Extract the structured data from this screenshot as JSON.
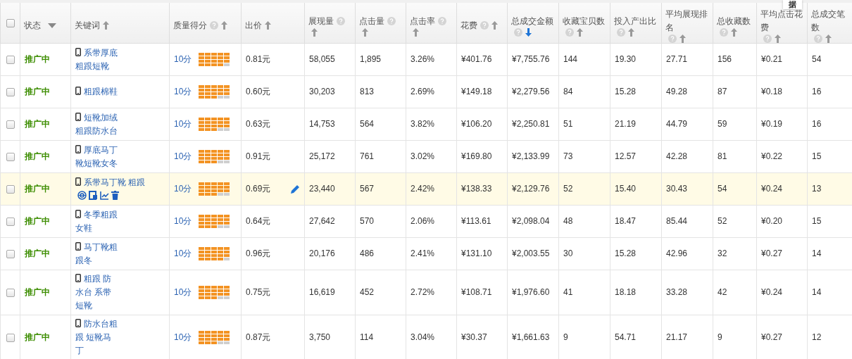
{
  "select_all": {
    "checked": false
  },
  "columns": [
    {
      "label": "状态",
      "help": false,
      "kind": "filter",
      "sorted": false
    },
    {
      "label": "关键词",
      "help": false,
      "kind": "sortable",
      "sorted": false
    },
    {
      "label": "质量得分",
      "help": true,
      "kind": "sortable",
      "sorted": false
    },
    {
      "label": "出价",
      "help": false,
      "kind": "sortable",
      "sorted": false
    },
    {
      "label": "展现量",
      "help": true,
      "kind": "sortable",
      "sorted": false
    },
    {
      "label": "点击量",
      "help": true,
      "kind": "sortable",
      "sorted": false
    },
    {
      "label": "点击率",
      "help": true,
      "kind": "sortable",
      "sorted": false
    },
    {
      "label": "花费",
      "help": true,
      "kind": "sortable",
      "sorted": false
    },
    {
      "label": "总成交金额",
      "help": true,
      "kind": "sortable",
      "sorted": true
    },
    {
      "label": "收藏宝贝数",
      "help": true,
      "kind": "sortable",
      "sorted": false
    },
    {
      "label": "投入产出比",
      "help": true,
      "kind": "sortable",
      "sorted": false
    },
    {
      "label": "平均展现排名",
      "help": true,
      "kind": "sortable",
      "sorted": false
    },
    {
      "label": "总收藏数",
      "help": true,
      "kind": "sortable",
      "sorted": false
    },
    {
      "label": "平均点击花费",
      "help": true,
      "kind": "sortable",
      "sorted": false
    },
    {
      "label": "总成交笔数",
      "help": true,
      "kind": "sortable",
      "sorted": false
    }
  ],
  "tooltip": "据",
  "rows": [
    {
      "checked": false,
      "highlighted": false,
      "status": "推广中",
      "keyword": "系带厚底粗跟短靴",
      "quality": {
        "score": "10分",
        "level": 0.95
      },
      "bid": "0.81元",
      "metrics": [
        "58,055",
        "1,895",
        "3.26%",
        "¥401.76",
        "¥7,755.76",
        "144",
        "19.30",
        "27.71",
        "156",
        "¥0.21",
        "54"
      ]
    },
    {
      "checked": false,
      "highlighted": false,
      "status": "推广中",
      "keyword": "粗跟棉鞋",
      "quality": {
        "score": "10分",
        "level": 0.9
      },
      "bid": "0.60元",
      "metrics": [
        "30,203",
        "813",
        "2.69%",
        "¥149.18",
        "¥2,279.56",
        "84",
        "15.28",
        "49.28",
        "87",
        "¥0.18",
        "16"
      ]
    },
    {
      "checked": false,
      "highlighted": false,
      "status": "推广中",
      "keyword": "短靴加绒粗跟防水台",
      "quality": {
        "score": "10分",
        "level": 0.9
      },
      "bid": "0.63元",
      "metrics": [
        "14,753",
        "564",
        "3.82%",
        "¥106.20",
        "¥2,250.81",
        "51",
        "21.19",
        "44.79",
        "59",
        "¥0.19",
        "16"
      ]
    },
    {
      "checked": false,
      "highlighted": false,
      "status": "推广中",
      "keyword": "厚底马丁靴短靴女冬",
      "quality": {
        "score": "10分",
        "level": 0.9
      },
      "bid": "0.91元",
      "metrics": [
        "25,172",
        "761",
        "3.02%",
        "¥169.80",
        "¥2,133.99",
        "73",
        "12.57",
        "42.28",
        "81",
        "¥0.22",
        "15"
      ]
    },
    {
      "checked": false,
      "highlighted": true,
      "status": "推广中",
      "keyword": "系带马丁靴 粗跟",
      "quality": {
        "score": "10分",
        "level": 0.9
      },
      "bid": "0.69元",
      "metrics": [
        "23,440",
        "567",
        "2.42%",
        "¥138.33",
        "¥2,129.76",
        "52",
        "15.40",
        "30.43",
        "54",
        "¥0.24",
        "13"
      ]
    },
    {
      "checked": false,
      "highlighted": false,
      "status": "推广中",
      "keyword": "冬季粗跟女鞋",
      "quality": {
        "score": "10分",
        "level": 0.9
      },
      "bid": "0.64元",
      "metrics": [
        "27,642",
        "570",
        "2.06%",
        "¥113.61",
        "¥2,098.04",
        "48",
        "18.47",
        "85.44",
        "52",
        "¥0.20",
        "15"
      ]
    },
    {
      "checked": false,
      "highlighted": false,
      "status": "推广中",
      "keyword": "马丁靴粗跟冬",
      "quality": {
        "score": "10分",
        "level": 0.95
      },
      "bid": "0.96元",
      "metrics": [
        "20,176",
        "486",
        "2.41%",
        "¥131.10",
        "¥2,003.55",
        "30",
        "15.28",
        "42.96",
        "32",
        "¥0.27",
        "14"
      ]
    },
    {
      "checked": false,
      "highlighted": false,
      "status": "推广中",
      "keyword": "粗跟 防水台 系带短靴",
      "quality": {
        "score": "10分",
        "level": 0.9
      },
      "bid": "0.75元",
      "metrics": [
        "16,619",
        "452",
        "2.72%",
        "¥108.71",
        "¥1,976.60",
        "41",
        "18.18",
        "33.28",
        "42",
        "¥0.24",
        "14"
      ]
    },
    {
      "checked": false,
      "highlighted": false,
      "status": "推广中",
      "keyword": "防水台粗跟 短靴马丁",
      "quality": {
        "score": "10分",
        "level": 0.9
      },
      "bid": "0.87元",
      "metrics": [
        "3,750",
        "114",
        "3.04%",
        "¥30.37",
        "¥1,661.63",
        "9",
        "54.71",
        "21.17",
        "9",
        "¥0.27",
        "12"
      ]
    }
  ]
}
